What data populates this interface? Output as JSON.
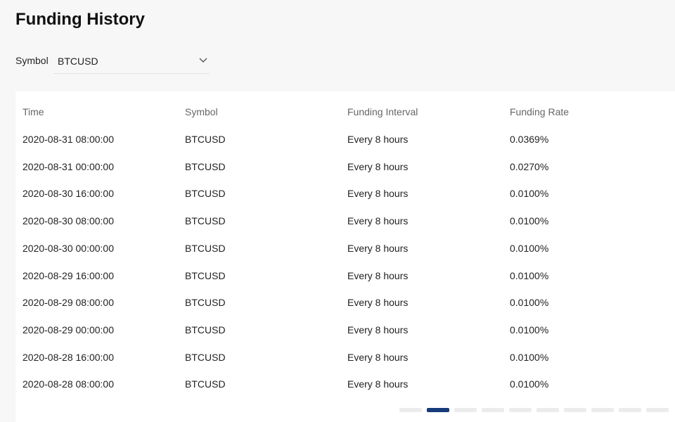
{
  "title": "Funding History",
  "filter": {
    "label": "Symbol",
    "value": "BTCUSD"
  },
  "table": {
    "headers": [
      "Time",
      "Symbol",
      "Funding Interval",
      "Funding Rate"
    ],
    "rows": [
      [
        "2020-08-31 08:00:00",
        "BTCUSD",
        "Every 8 hours",
        "0.0369%"
      ],
      [
        "2020-08-31 00:00:00",
        "BTCUSD",
        "Every 8 hours",
        "0.0270%"
      ],
      [
        "2020-08-30 16:00:00",
        "BTCUSD",
        "Every 8 hours",
        "0.0100%"
      ],
      [
        "2020-08-30 08:00:00",
        "BTCUSD",
        "Every 8 hours",
        "0.0100%"
      ],
      [
        "2020-08-30 00:00:00",
        "BTCUSD",
        "Every 8 hours",
        "0.0100%"
      ],
      [
        "2020-08-29 16:00:00",
        "BTCUSD",
        "Every 8 hours",
        "0.0100%"
      ],
      [
        "2020-08-29 08:00:00",
        "BTCUSD",
        "Every 8 hours",
        "0.0100%"
      ],
      [
        "2020-08-29 00:00:00",
        "BTCUSD",
        "Every 8 hours",
        "0.0100%"
      ],
      [
        "2020-08-28 16:00:00",
        "BTCUSD",
        "Every 8 hours",
        "0.0100%"
      ],
      [
        "2020-08-28 08:00:00",
        "BTCUSD",
        "Every 8 hours",
        "0.0100%"
      ]
    ]
  },
  "pagination": {
    "page_count_visible": 10,
    "active_index": 1,
    "accent": "#173a7a"
  }
}
